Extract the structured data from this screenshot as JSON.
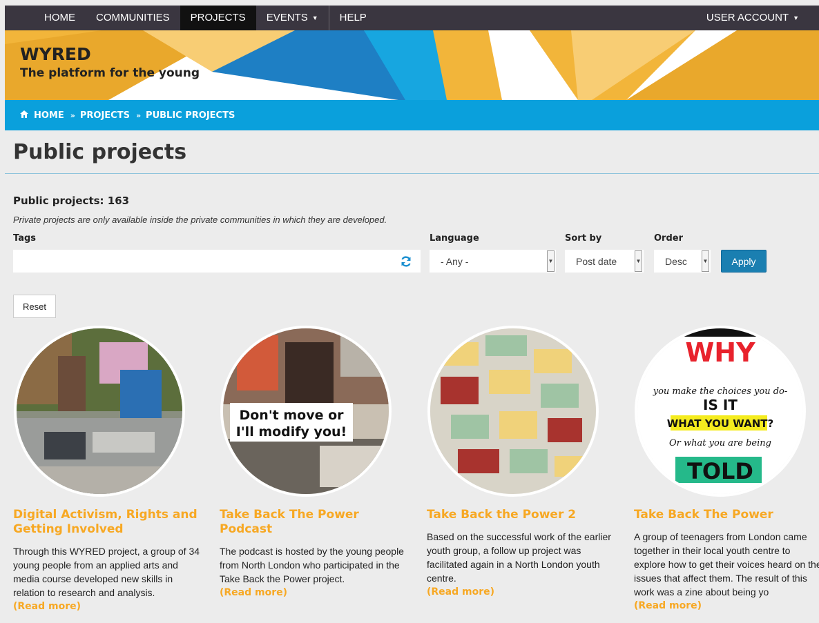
{
  "nav": {
    "items": [
      "HOME",
      "COMMUNITIES",
      "PROJECTS",
      "EVENTS",
      "HELP"
    ],
    "active": "PROJECTS",
    "account": "USER ACCOUNT"
  },
  "brand": {
    "title": "WYRED",
    "subtitle": "The platform for the young"
  },
  "breadcrumb": [
    "HOME",
    "PROJECTS",
    "PUBLIC PROJECTS"
  ],
  "page": {
    "title": "Public projects",
    "count": "Public projects: 163",
    "note": "Private projects are only available inside the private communities in which they are developed."
  },
  "filters": {
    "tags_label": "Tags",
    "tags_value": "",
    "language_label": "Language",
    "language_value": "- Any -",
    "sort_label": "Sort by",
    "sort_value": "Post date",
    "order_label": "Order",
    "order_value": "Desc",
    "apply": "Apply",
    "reset": "Reset"
  },
  "cards": [
    {
      "title": "Digital Activism, Rights and Getting Involved",
      "desc": "Through this WYRED project, a group of 34 young people from an applied arts and media course developed new skills in relation to research and analysis.",
      "more": "(Read more)"
    },
    {
      "title": "Take Back The Power Podcast",
      "desc": "The podcast is hosted by the young people from North London who participated in the Take Back the Power project.",
      "more": "(Read more)",
      "image_text": [
        "Don't move or",
        "I'll modify you!"
      ]
    },
    {
      "title": "Take Back the Power 2",
      "desc": "Based on the successful work of the earlier youth group, a follow up project was facilitated again in a North London youth centre.",
      "more": "(Read more)"
    },
    {
      "title": "Take Back The Power",
      "desc": "A group of teenagers from London came together in their local youth centre to explore how to get their voices heard on the issues that affect them. The result of this work was a zine about being yo",
      "more": "(Read more)",
      "image_text": [
        "WHY",
        "you make the choices you do-",
        "IS IT",
        "WHAT YOU WANT?",
        "Or what you are being",
        "TOLD"
      ]
    }
  ],
  "colors": {
    "nav_bg": "#3a3640",
    "breadcrumb_bg": "#0aa0dc",
    "accent_orange": "#f7a823",
    "apply_bg": "#1a7fb1",
    "banner_yellow": "#f2b53a"
  },
  "icons": {
    "home": "home-icon",
    "refresh": "refresh-icon",
    "caret": "caret-down-icon",
    "breadcrumb_separator": "double-chevron-right-icon"
  }
}
